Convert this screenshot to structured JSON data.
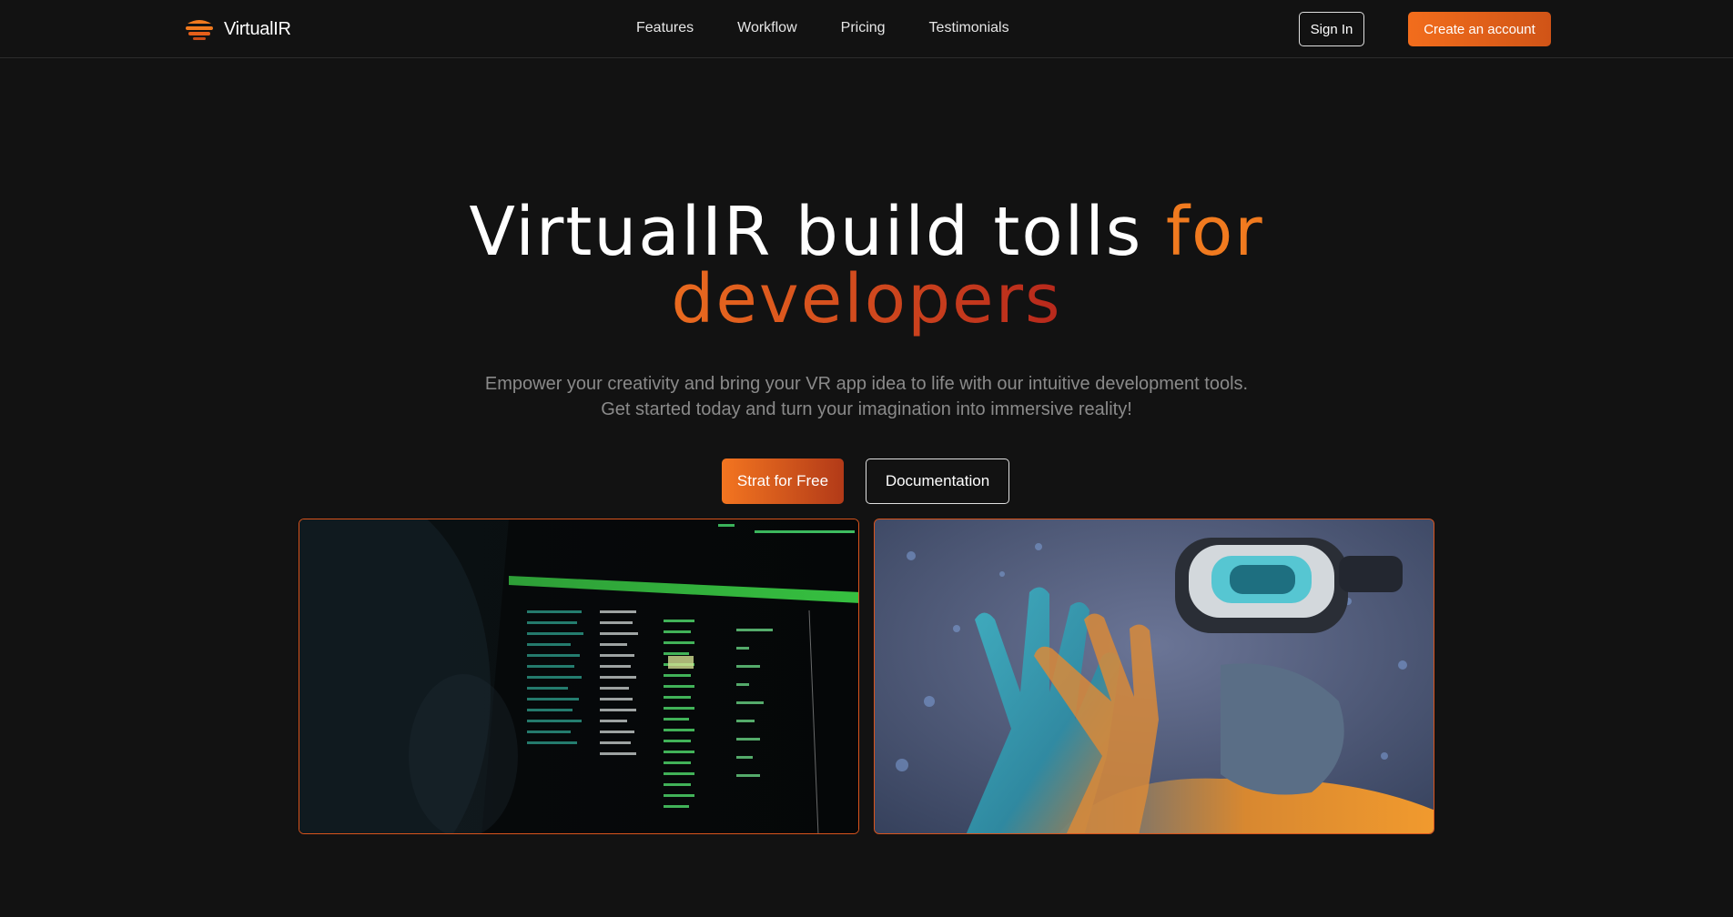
{
  "brand": {
    "name": "VirtualIR",
    "accent": "#f07a1f"
  },
  "nav": {
    "links": [
      "Features",
      "Workflow",
      "Pricing",
      "Testimonials"
    ],
    "sign_in": "Sign In",
    "create_account": "Create an account"
  },
  "hero": {
    "title_main": "VirtualIR build tolls ",
    "title_accent1": "for",
    "title_accent2": "developers",
    "subtitle_line1": "Empower your creativity and bring your VR app idea to life with our intuitive development tools.",
    "subtitle_line2": "Get started today and turn your imagination into immersive reality!",
    "primary_cta": "Strat for Free",
    "secondary_cta": "Documentation"
  },
  "media": {
    "left_icon": "terminal-monitor-image",
    "right_icon": "vr-headset-person-image"
  },
  "colors": {
    "background": "#121212",
    "accent_orange": "#f26d1c",
    "accent_red": "#b7281c",
    "muted_text": "#8a8a8a"
  }
}
